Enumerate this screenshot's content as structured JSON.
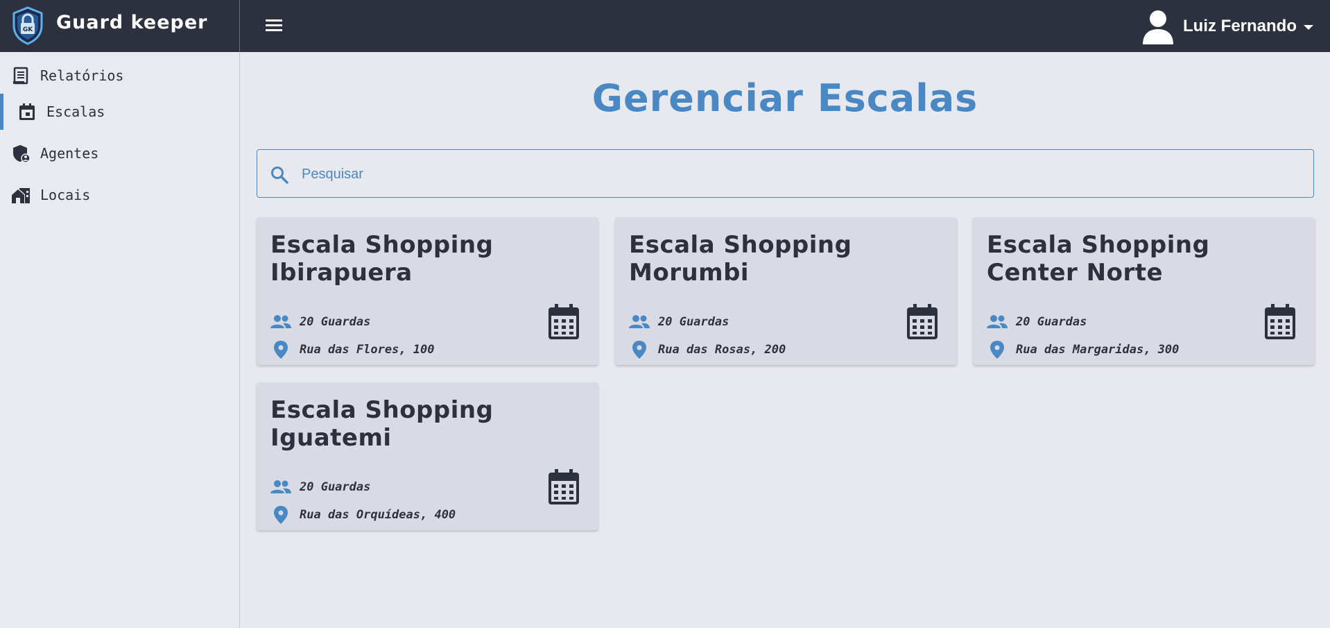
{
  "header": {
    "brand": "Guard keeper",
    "user_name": "Luiz Fernando"
  },
  "sidebar": {
    "items": [
      {
        "label": "Relatórios",
        "icon": "report-icon"
      },
      {
        "label": "Escalas",
        "icon": "calendar-icon",
        "active": true
      },
      {
        "label": "Agentes",
        "icon": "shield-user-icon"
      },
      {
        "label": "Locais",
        "icon": "buildings-icon"
      }
    ]
  },
  "main": {
    "title": "Gerenciar Escalas",
    "search_placeholder": "Pesquisar",
    "cards": [
      {
        "title": "Escala Shopping Ibirapuera",
        "guards": "20 Guardas",
        "address": "Rua das Flores, 100"
      },
      {
        "title": "Escala Shopping Morumbi",
        "guards": "20 Guardas",
        "address": "Rua das Rosas, 200"
      },
      {
        "title": "Escala Shopping Center Norte",
        "guards": "20 Guardas",
        "address": "Rua das Margaridas, 300"
      },
      {
        "title": "Escala Shopping Iguatemi",
        "guards": "20 Guardas",
        "address": "Rua das Orquídeas, 400"
      }
    ]
  },
  "colors": {
    "topbar": "#2d303d",
    "accent": "#4a88c4",
    "background": "#e8e9ee",
    "card": "#d9dbe4"
  }
}
